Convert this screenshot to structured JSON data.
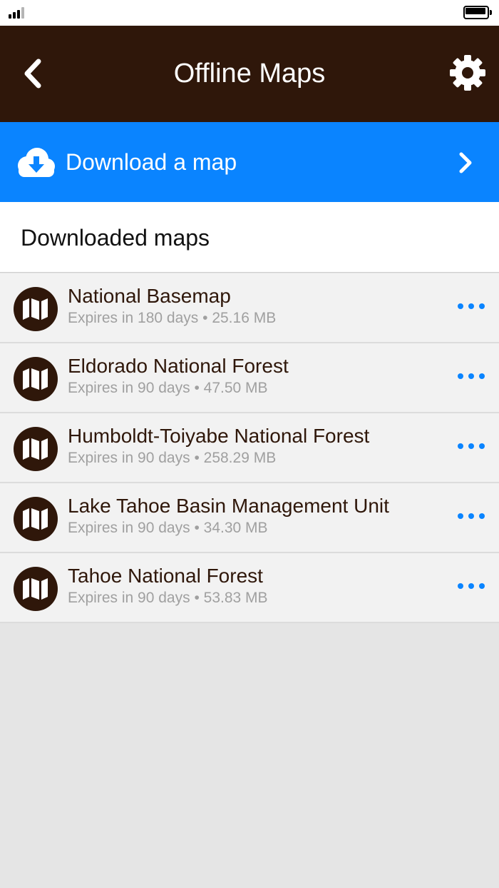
{
  "colors": {
    "nav_background": "#2f170a",
    "accent": "#0a84ff",
    "signal_dim": "#b5b5b5"
  },
  "status_bar": {
    "signal_icon": "signal-bars-icon",
    "battery_icon": "battery-icon"
  },
  "header": {
    "title": "Offline Maps",
    "back_icon": "chevron-left-icon",
    "settings_icon": "gear-icon"
  },
  "download": {
    "label": "Download a map",
    "icon": "cloud-download-icon",
    "chevron_icon": "chevron-right-icon"
  },
  "section": {
    "title": "Downloaded maps"
  },
  "maps": [
    {
      "name": "National Basemap",
      "expires": "Expires in 180 days",
      "size": "25.16 MB"
    },
    {
      "name": "Eldorado National Forest",
      "expires": "Expires in 90 days",
      "size": "47.50 MB"
    },
    {
      "name": "Humboldt-Toiyabe National Forest",
      "expires": "Expires in 90 days",
      "size": "258.29 MB"
    },
    {
      "name": "Lake Tahoe Basin Management Unit",
      "expires": "Expires in 90 days",
      "size": "34.30 MB"
    },
    {
      "name": "Tahoe National Forest",
      "expires": "Expires in 90 days",
      "size": "53.83 MB"
    }
  ],
  "meta_separator": "•"
}
